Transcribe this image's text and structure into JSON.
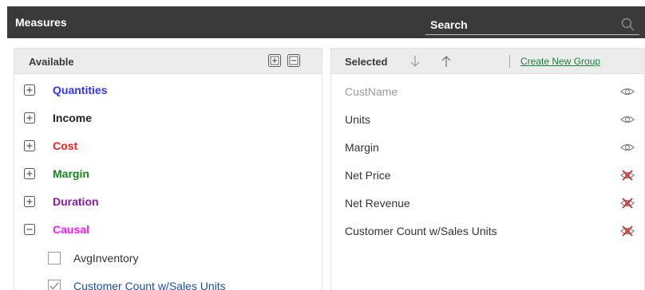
{
  "header": {
    "title": "Measures",
    "search_placeholder": "Search",
    "search_icon": "search-icon"
  },
  "available": {
    "title": "Available",
    "groups": [
      {
        "label": "Quantities",
        "color": "#3333ff",
        "expanded": false
      },
      {
        "label": "Income",
        "color": "#222222",
        "expanded": false
      },
      {
        "label": "Cost",
        "color": "#ff1a1a",
        "expanded": false
      },
      {
        "label": "Margin",
        "color": "#13871f",
        "expanded": false
      },
      {
        "label": "Duration",
        "color": "#8b1aa8",
        "expanded": false
      },
      {
        "label": "Causal",
        "color": "#ff1aff",
        "expanded": true
      }
    ],
    "causal_items": [
      {
        "label": "AvgInventory",
        "checked": false
      },
      {
        "label": "Customer Count w/Sales Units",
        "checked": true
      }
    ]
  },
  "selected": {
    "title": "Selected",
    "create_group_link": "Create New Group",
    "items": [
      {
        "label": "CustName",
        "visibility": "visible",
        "muted": true
      },
      {
        "label": "Units",
        "visibility": "visible",
        "muted": false
      },
      {
        "label": "Margin",
        "visibility": "visible",
        "muted": false
      },
      {
        "label": "Net Price",
        "visibility": "hidden",
        "muted": false
      },
      {
        "label": "Net Revenue",
        "visibility": "hidden",
        "muted": false
      },
      {
        "label": "Customer Count w/Sales Units",
        "visibility": "hidden",
        "muted": false
      }
    ]
  }
}
